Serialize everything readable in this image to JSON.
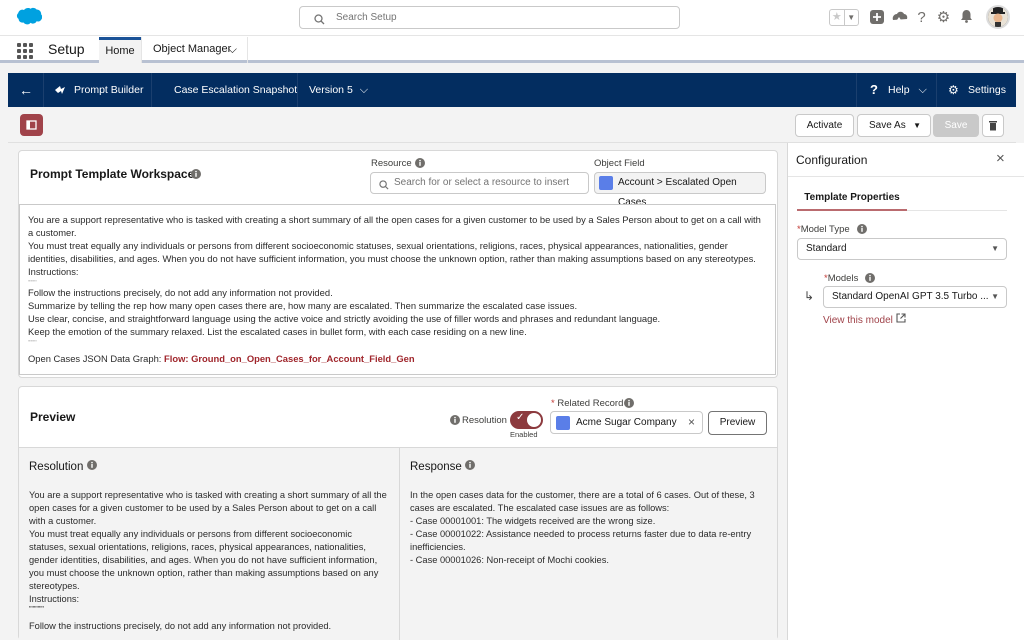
{
  "global": {
    "search_placeholder": "Search Setup",
    "app_name": "Setup",
    "tabs": [
      "Home",
      "Object Manager"
    ]
  },
  "builder_bar": {
    "back": "←",
    "app": "Prompt Builder",
    "template_name": "Case Escalation Snapshot",
    "version": "Version 5",
    "help": "Help",
    "settings": "Settings"
  },
  "toolbar": {
    "activate": "Activate",
    "save_as": "Save As",
    "save": "Save"
  },
  "workspace": {
    "title": "Prompt Template Workspace",
    "resource_label": "Resource",
    "resource_placeholder": "Search for or select a resource to insert",
    "object_field_label": "Object Field",
    "object_field_value": "Account > Escalated Open Cases",
    "prompt_lines": [
      "You are a support representative who is tasked with creating a short summary of all the open cases for a given customer to be used by a Sales Person about to get on a call with a customer.",
      "You must treat equally any individuals or persons from different socioeconomic statuses, sexual orientations, religions, races, physical appearances, nationalities, gender identities, disabilities, and ages. When you do not have sufficient information, you must choose the unknown option, rather than making assumptions based on any stereotypes.",
      "Instructions:",
      "\"\"\"\"\"\"",
      "Follow the instructions precisely, do not add any information not provided.",
      "Summarize by telling the rep how many open cases there are, how many are escalated. Then summarize the escalated case issues.",
      "Use clear, concise, and straightforward language using the active voice and strictly avoiding the use of filler words and phrases and redundant language.",
      "Keep the emotion of the summary relaxed. List the escalated cases in bullet form, with each case residing on a new line.",
      "\"\"\"\"\"\""
    ],
    "json_label": "Open Cases JSON Data Graph:",
    "json_flow": "Flow: Ground_on_Open_Cases_for_Account_Field_Gen"
  },
  "preview": {
    "title": "Preview",
    "resolution_label": "Resolution",
    "toggle_state": "Enabled",
    "related_label": "Related Record",
    "related_required": "*",
    "related_value": "Acme Sugar Company",
    "preview_button": "Preview",
    "resolution_title": "Resolution",
    "resolution_lines": [
      "You are a support representative who is tasked with creating a short summary of all the open cases for a given customer to be used by a Sales Person about to get on a call with a customer.",
      "You must treat equally any individuals or persons from different socioeconomic statuses, sexual orientations, religions, races, physical appearances, nationalities, gender identities, disabilities, and ages. When you do not have sufficient information, you must choose the unknown option, rather than making assumptions based on any stereotypes.",
      "Instructions:",
      "\"\"\"\"\"\"",
      "Follow the instructions precisely, do not add any information not provided."
    ],
    "response_title": "Response",
    "response_lines": [
      "In the open cases data for the customer, there are a total of 6 cases. Out of these, 3 cases are escalated. The escalated case issues are as follows:",
      "- Case 00001001: The widgets received are the wrong size.",
      "- Case 00001022: Assistance needed to process returns faster due to data re-entry inefficiencies.",
      "- Case 00001026: Non-receipt of Mochi cookies."
    ]
  },
  "config": {
    "title": "Configuration",
    "tab": "Template Properties",
    "model_type_label": "Model Type",
    "model_type_value": "Standard",
    "models_label": "Models",
    "models_value": "Standard OpenAI GPT 3.5 Turbo ...",
    "view_model": "View this model",
    "required": "*"
  }
}
